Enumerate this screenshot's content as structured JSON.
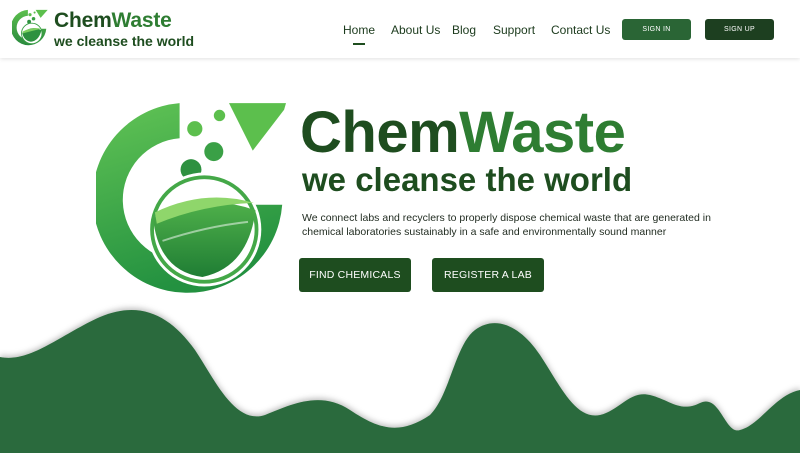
{
  "header": {
    "brand_name_part1": "Chem",
    "brand_name_part2": "Waste",
    "brand_tagline": "we cleanse the world",
    "nav": [
      {
        "label": "Home",
        "active": true
      },
      {
        "label": "About Us",
        "active": false
      },
      {
        "label": "Blog",
        "active": false
      },
      {
        "label": "Support",
        "active": false
      },
      {
        "label": "Contact Us",
        "active": false
      }
    ],
    "sign_in_label": "SIGN IN",
    "sign_up_label": "SIGN UP"
  },
  "hero": {
    "title_part1": "Chem",
    "title_part2": "Waste",
    "tagline": "we cleanse the world",
    "description": "We connect labs and recyclers to properly dispose chemical waste that are generated in chemical laboratories sustainably in a safe and environmentally sound manner",
    "find_chemicals_label": "FIND CHEMICALS",
    "register_lab_label": "REGISTER A LAB"
  },
  "icons": {
    "logo": "flask-leaf-logo-icon"
  },
  "colors": {
    "brand_dark": "#1e4d1f",
    "brand_green": "#2e7d32",
    "logo_light": "#5cbf4d",
    "wave": "#2b6a3c"
  }
}
